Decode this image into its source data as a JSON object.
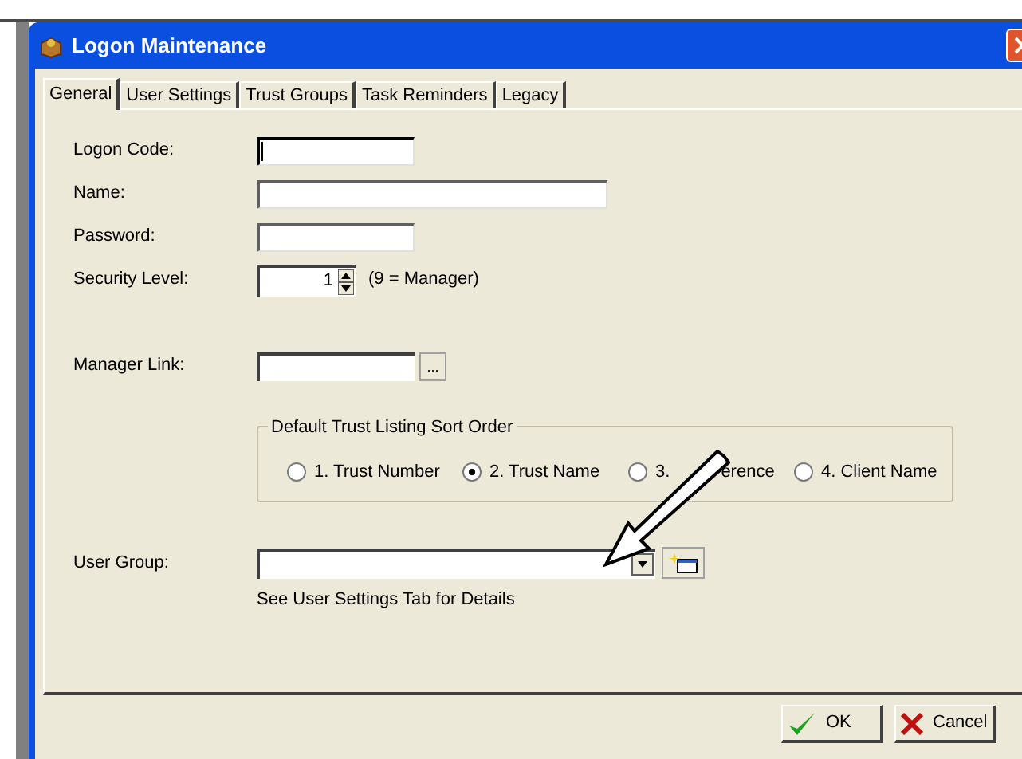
{
  "window": {
    "title": "Logon Maintenance"
  },
  "tabs": [
    {
      "label": "General",
      "selected": true
    },
    {
      "label": "User Settings",
      "selected": false
    },
    {
      "label": "Trust Groups",
      "selected": false
    },
    {
      "label": "Task Reminders",
      "selected": false
    },
    {
      "label": "Legacy",
      "selected": false
    }
  ],
  "fields": [
    {
      "kind": "short_text",
      "label": "Logon Code:",
      "focused": true
    },
    {
      "kind": "long_text",
      "label": "Name:",
      "focused": false
    },
    {
      "kind": "short_text",
      "label": "Password:",
      "focused": false
    },
    {
      "kind": "spinner",
      "label": "Security Level:",
      "value": "1",
      "hint": "(9 = Manager)"
    },
    {
      "kind": "lookup",
      "label": "Manager Link:",
      "button": "..."
    }
  ],
  "sort_order": {
    "title": "Default Trust Listing Sort Order",
    "options": [
      {
        "label": "1. Trust Number",
        "selected": false
      },
      {
        "label": "2. Trust Name",
        "selected": true
      },
      {
        "label": "3.",
        "tail": "erence",
        "selected": false
      },
      {
        "label": "4. Client Name",
        "selected": false
      }
    ]
  },
  "user_group": {
    "label": "User Group:",
    "note": "See User Settings Tab for Details"
  },
  "buttons": [
    {
      "kind": "ok",
      "label": "OK"
    },
    {
      "kind": "cancel",
      "label": "Cancel"
    }
  ]
}
